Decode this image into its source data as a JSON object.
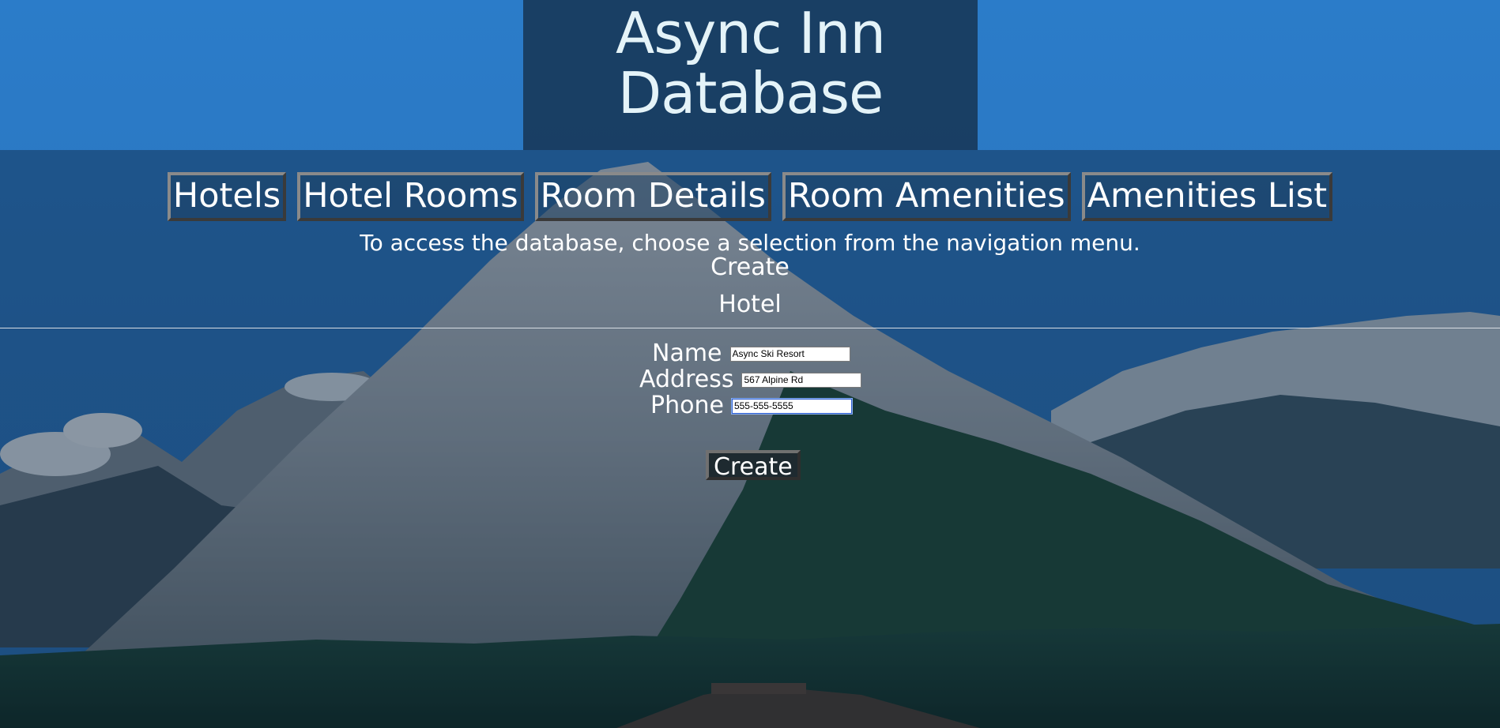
{
  "header": {
    "title_line1": "Async Inn",
    "title_line2": "Database"
  },
  "nav": {
    "items": [
      {
        "label": "Hotels"
      },
      {
        "label": "Hotel Rooms"
      },
      {
        "label": "Room Details"
      },
      {
        "label": "Room Amenities"
      },
      {
        "label": "Amenities List"
      }
    ]
  },
  "intro_text": "To access the database, choose a selection from the navigation menu.",
  "page": {
    "heading": "Create",
    "subheading": "Hotel"
  },
  "form": {
    "name_label": "Name",
    "name_value": "Async Ski Resort",
    "address_label": "Address",
    "address_value": "567 Alpine Rd",
    "phone_label": "Phone",
    "phone_value": "555-555-5555",
    "submit_label": "Create"
  },
  "colors": {
    "sky": "#2a7ac7",
    "title_panel": "#183a5c",
    "title_text": "#e4f3f8"
  }
}
